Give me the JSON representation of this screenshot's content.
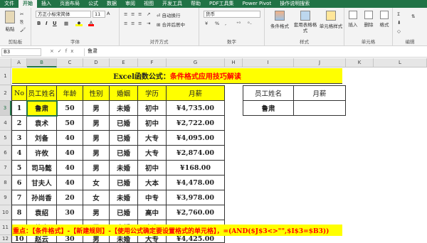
{
  "menu_tabs": [
    "文件",
    "开始",
    "插入",
    "页面布局",
    "公式",
    "数据",
    "审阅",
    "视图",
    "开发工具",
    "帮助",
    "PDF工具集",
    "Power Pivot",
    "操作说明搜索"
  ],
  "ribbon": {
    "clipboard": {
      "paste": "粘贴",
      "title": "剪贴板"
    },
    "font": {
      "name": "方正小标宋简体",
      "size": "11",
      "bold": "B",
      "italic": "I",
      "underline": "U",
      "title": "字体"
    },
    "alignment": {
      "wrap": "自动换行",
      "merge": "合并后居中",
      "title": "对齐方式"
    },
    "number": {
      "format": "货币",
      "title": "数字"
    },
    "styles": {
      "conditional": "条件格式",
      "table": "套用表格格式",
      "cell": "单元格样式",
      "title": "样式"
    },
    "cells": {
      "insert": "插入",
      "delete": "删除",
      "format": "格式",
      "title": "单元格"
    },
    "editing": {
      "title": "编辑"
    }
  },
  "formula_bar": {
    "name_box": "B3",
    "fx_icons": "×✓fx",
    "content": "鲁肃"
  },
  "columns": [
    "A",
    "B",
    "C",
    "D",
    "E",
    "F",
    "G",
    "H",
    "I",
    "J",
    "K",
    "L"
  ],
  "rows": [
    "1",
    "2",
    "3",
    "4",
    "5",
    "6",
    "7",
    "8",
    "9",
    "10",
    "11",
    "12"
  ],
  "sheet": {
    "title_prefix": "Excel函数公式：",
    "title_main": "条件格式应用技巧解读",
    "headers": [
      "No",
      "员工姓名",
      "年龄",
      "性别",
      "婚姻",
      "学历",
      "月薪"
    ],
    "records": [
      [
        "1",
        "鲁肃",
        "50",
        "男",
        "未婚",
        "初中",
        "¥4,735.00"
      ],
      [
        "2",
        "袁术",
        "50",
        "男",
        "已婚",
        "初中",
        "¥2,722.00"
      ],
      [
        "3",
        "刘备",
        "40",
        "男",
        "已婚",
        "大专",
        "¥4,095.00"
      ],
      [
        "4",
        "许攸",
        "40",
        "男",
        "已婚",
        "大专",
        "¥2,874.00"
      ],
      [
        "5",
        "司马懿",
        "40",
        "男",
        "未婚",
        "初中",
        "¥168.00"
      ],
      [
        "6",
        "甘夫人",
        "40",
        "女",
        "已婚",
        "大本",
        "¥4,478.00"
      ],
      [
        "7",
        "孙尚香",
        "20",
        "女",
        "未婚",
        "中专",
        "¥3,978.00"
      ],
      [
        "8",
        "袁绍",
        "30",
        "男",
        "已婚",
        "高中",
        "¥2,760.00"
      ],
      [
        "9",
        "徐庶",
        "30",
        "男",
        "未婚",
        "大专",
        "¥3,762.00"
      ],
      [
        "10",
        "赵云",
        "30",
        "男",
        "未婚",
        "大专",
        "¥4,425.00"
      ]
    ],
    "query_headers": [
      "员工姓名",
      "月薪"
    ],
    "query_values": [
      "鲁肃",
      ""
    ],
    "note": "重点：【条件格式】-【新建规则】-【使用公式确定要设置格式的单元格】，=(AND($J$3<>\"\",$I$3=$B3))"
  }
}
